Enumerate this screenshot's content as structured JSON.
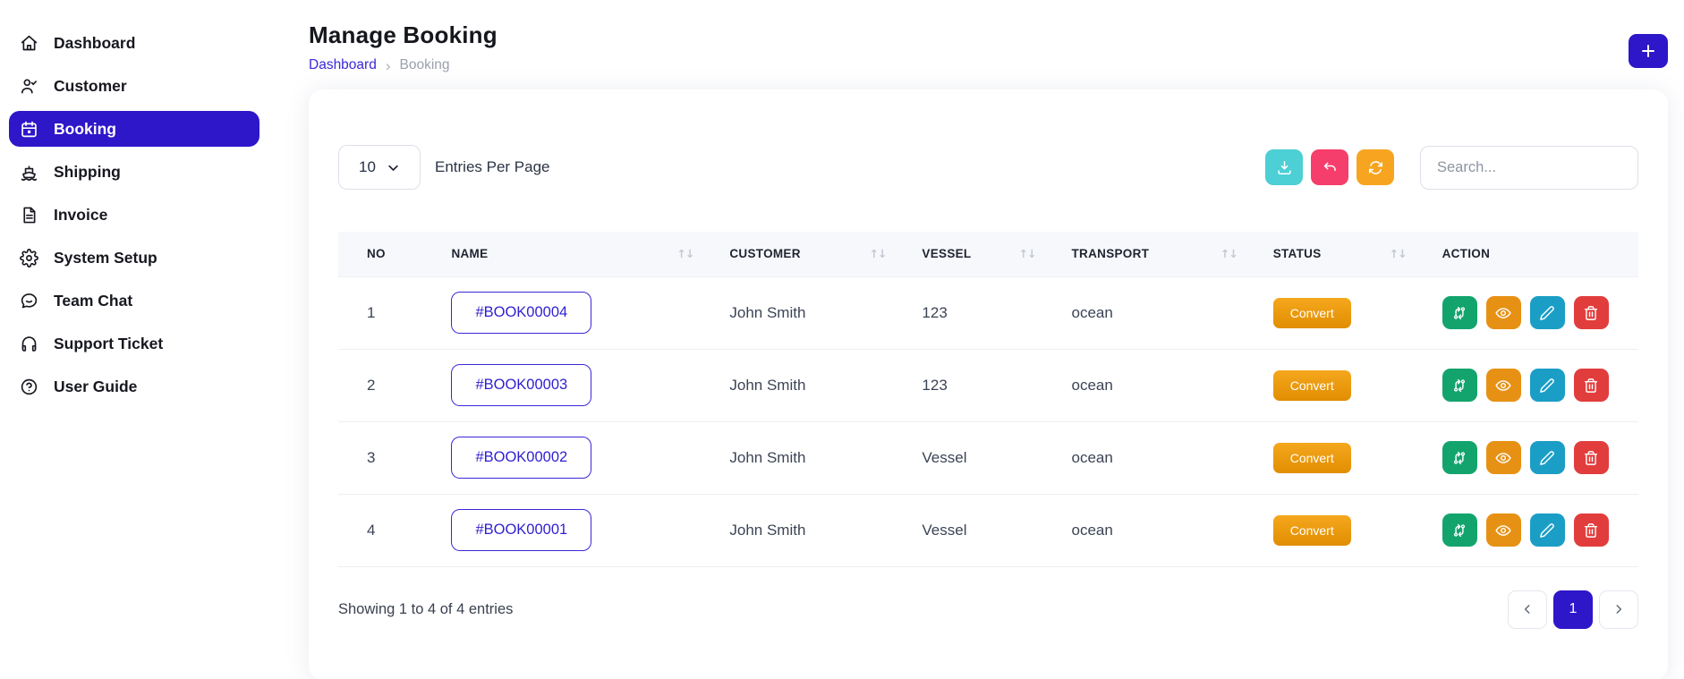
{
  "page": {
    "title": "Manage Booking",
    "breadcrumb": {
      "link_label": "Dashboard",
      "separator": "›",
      "current": "Booking"
    }
  },
  "sidebar": {
    "items": [
      {
        "label": "Dashboard",
        "icon": "home-icon",
        "active": false
      },
      {
        "label": "Customer",
        "icon": "customer-icon",
        "active": false
      },
      {
        "label": "Booking",
        "icon": "calendar-icon",
        "active": true
      },
      {
        "label": "Shipping",
        "icon": "ship-icon",
        "active": false
      },
      {
        "label": "Invoice",
        "icon": "invoice-icon",
        "active": false
      },
      {
        "label": "System Setup",
        "icon": "gear-icon",
        "active": false
      },
      {
        "label": "Team Chat",
        "icon": "chat-icon",
        "active": false
      },
      {
        "label": "Support Ticket",
        "icon": "headset-icon",
        "active": false
      },
      {
        "label": "User Guide",
        "icon": "help-icon",
        "active": false
      }
    ]
  },
  "toolbar": {
    "entries_per_page": {
      "value": "10",
      "label": "Entries Per Page"
    },
    "buttons": [
      {
        "name": "export-button",
        "icon": "download-icon",
        "color": "#4ccfd5"
      },
      {
        "name": "undo-button",
        "icon": "undo-icon",
        "color": "#f53e6b"
      },
      {
        "name": "refresh-button",
        "icon": "refresh-icon",
        "color": "#f7a521"
      }
    ],
    "search_placeholder": "Search..."
  },
  "table": {
    "columns": [
      {
        "label": "NO",
        "sortable": false
      },
      {
        "label": "NAME",
        "sortable": true
      },
      {
        "label": "CUSTOMER",
        "sortable": true
      },
      {
        "label": "VESSEL",
        "sortable": true
      },
      {
        "label": "TRANSPORT",
        "sortable": true
      },
      {
        "label": "STATUS",
        "sortable": true
      },
      {
        "label": "ACTION",
        "sortable": false
      }
    ],
    "rows": [
      {
        "no": "1",
        "name": "#BOOK00004",
        "customer": "John Smith",
        "vessel": "123",
        "transport": "ocean",
        "status": "Convert"
      },
      {
        "no": "2",
        "name": "#BOOK00003",
        "customer": "John Smith",
        "vessel": "123",
        "transport": "ocean",
        "status": "Convert"
      },
      {
        "no": "3",
        "name": "#BOOK00002",
        "customer": "John Smith",
        "vessel": "Vessel",
        "transport": "ocean",
        "status": "Convert"
      },
      {
        "no": "4",
        "name": "#BOOK00001",
        "customer": "John Smith",
        "vessel": "Vessel",
        "transport": "ocean",
        "status": "Convert"
      }
    ],
    "row_actions": [
      {
        "name": "transfer-button",
        "icon": "swap-icon",
        "color": "#13a46e"
      },
      {
        "name": "view-button",
        "icon": "eye-icon",
        "color": "#e79114"
      },
      {
        "name": "edit-button",
        "icon": "pencil-icon",
        "color": "#1b9ec6"
      },
      {
        "name": "delete-button",
        "icon": "trash-icon",
        "color": "#e23d3d"
      }
    ],
    "status_button_gradient": [
      "#f5a71d",
      "#e18e02"
    ]
  },
  "footer": {
    "summary": "Showing 1 to 4 of 4 entries",
    "pagination": {
      "current_page": "1"
    }
  },
  "colors": {
    "accent": "#2e16c9"
  }
}
